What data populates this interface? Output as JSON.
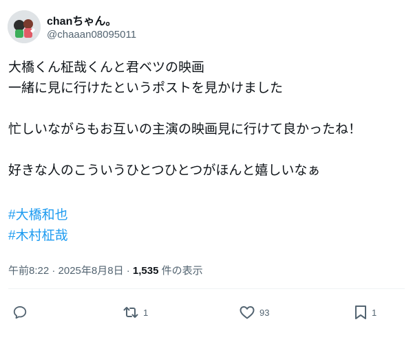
{
  "user": {
    "display_name": "chanちゃん。",
    "handle": "@chaaan08095011"
  },
  "tweet": {
    "lines": [
      "大橋くん柾哉くんと君ベツの映画",
      "一緒に見に行けたというポストを見かけました",
      "忙しいながらもお互いの主演の映画見に行けて良かったね！",
      "好きな人のこういうひとつひとつがほんと嬉しいなぁ"
    ],
    "hashtags": [
      "#大橋和也",
      "#木村柾哉"
    ]
  },
  "meta": {
    "timestamp": "午前8:22 · 2025年8月8日 · ",
    "views_count": "1,535",
    "views_label": " 件の表示"
  },
  "actions": {
    "reply_icon": "reply-icon",
    "retweet_icon": "retweet-icon",
    "retweet_count": "1",
    "like_icon": "heart-icon",
    "like_count": "93",
    "bookmark_icon": "bookmark-icon",
    "bookmark_count": "1"
  },
  "colors": {
    "text": "#0f1419",
    "secondary": "#536471",
    "link": "#1d9bf0",
    "divider": "#eff3f4"
  }
}
